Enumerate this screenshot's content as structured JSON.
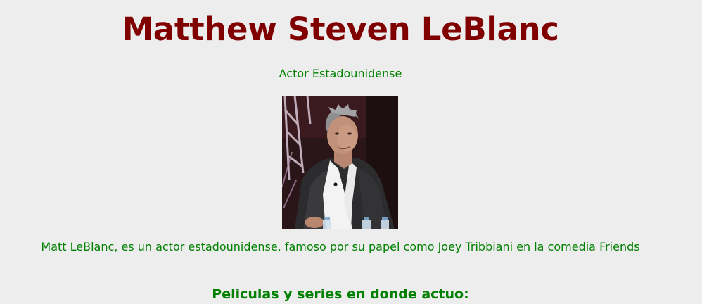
{
  "page": {
    "title": "Matthew Steven LeBlanc",
    "subtitle": "Actor Estadounidense",
    "bio": "Matt LeBlanc, es un actor estadounidense, famoso por su papel como Joey Tribbiani en la comedia Friends",
    "section_heading": "Peliculas y series en donde actuo:"
  },
  "colors": {
    "title": "#800000",
    "text": "#008000",
    "background": "#ededed"
  }
}
